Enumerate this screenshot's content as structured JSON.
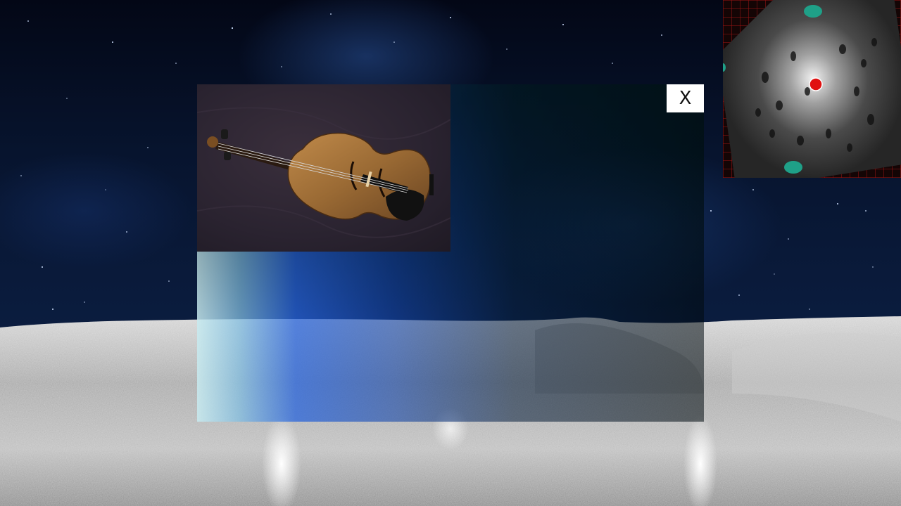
{
  "dialog": {
    "close_label": "X",
    "image_subject": "violin"
  },
  "minimap": {
    "player_marker_color": "#e01010",
    "waypoint_color": "#1fa088"
  },
  "colors": {
    "sky_top": "#030716",
    "sky_bottom": "#0b1d40",
    "terrain": "#b8b8b8",
    "panel_accent": "#2a64d8"
  }
}
